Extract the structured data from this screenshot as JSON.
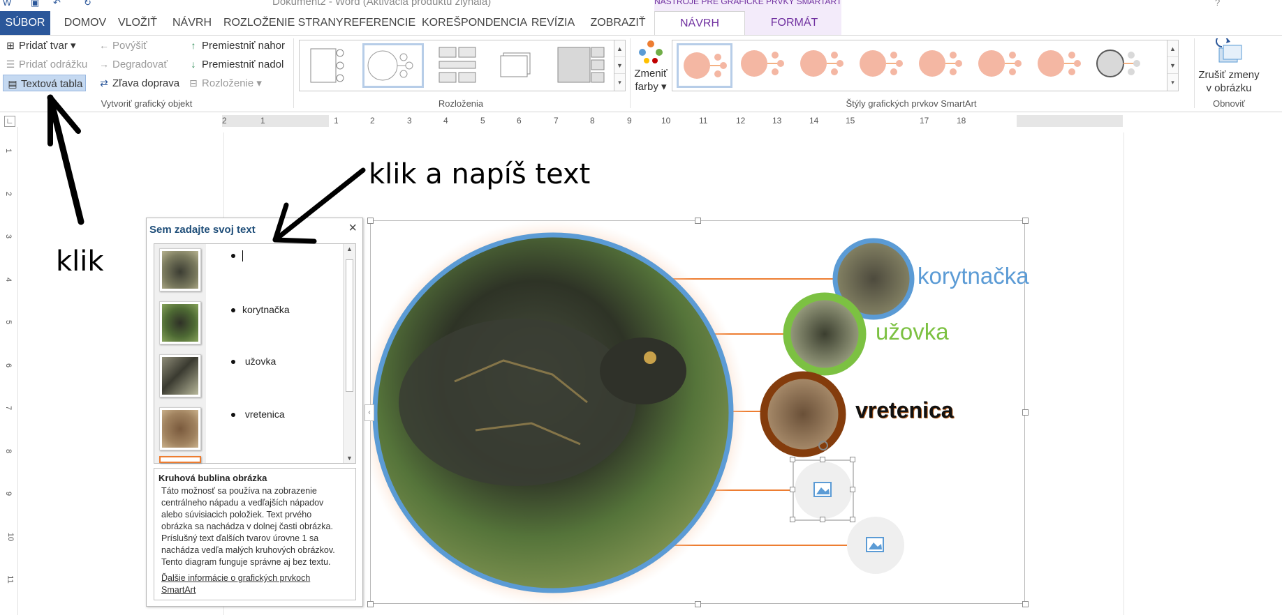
{
  "window": {
    "title": "Dokument2 - Word (Aktivácia produktu zlyhala)",
    "contextual_group": "NÁSTROJE PRE GRAFICKÉ PRVKY SMARTART"
  },
  "tabs": [
    {
      "label": "SÚBOR"
    },
    {
      "label": "DOMOV"
    },
    {
      "label": "VLOŽIŤ"
    },
    {
      "label": "NÁVRH"
    },
    {
      "label": "ROZLOŽENIE STRANY"
    },
    {
      "label": "REFERENCIE"
    },
    {
      "label": "KOREŠPONDENCIA"
    },
    {
      "label": "REVÍZIA"
    },
    {
      "label": "ZOBRAZIŤ"
    },
    {
      "label": "NÁVRH"
    },
    {
      "label": "FORMÁT"
    }
  ],
  "ribbon": {
    "create_group": {
      "label": "Vytvoriť grafický objekt",
      "add_shape": "Pridať tvar",
      "add_bullet": "Pridať odrážku",
      "text_pane": "Textová tabla",
      "promote": "Povýšiť",
      "demote": "Degradovať",
      "rtl": "Zľava doprava",
      "move_up": "Premiestniť nahor",
      "move_down": "Premiestniť nadol",
      "layout": "Rozloženie"
    },
    "layouts_group": {
      "label": "Rozloženia"
    },
    "styles_group": {
      "label": "Štýly grafických prvkov SmartArt",
      "change_colors_line1": "Zmeniť",
      "change_colors_line2": "farby"
    },
    "reset_group": {
      "label": "Obnoviť",
      "reset_line1": "Zrušiť zmeny",
      "reset_line2": "v obrázku"
    }
  },
  "ruler": {
    "h_numbers": [
      "2",
      "1",
      "1",
      "2",
      "3",
      "4",
      "5",
      "6",
      "7",
      "8",
      "9",
      "10",
      "11",
      "12",
      "13",
      "14",
      "15",
      "17",
      "18"
    ],
    "v_numbers": [
      "1",
      "2",
      "3",
      "4",
      "5",
      "6",
      "7",
      "8",
      "9",
      "10",
      "11"
    ]
  },
  "text_pane": {
    "title": "Sem zadajte svoj text",
    "items": [
      "",
      "korytnačka",
      "užovka",
      "vretenica"
    ],
    "desc_title": "Kruhová bublina obrázka",
    "desc_lines": [
      "Táto možnosť sa používa na zobrazenie",
      "centrálneho nápadu a vedľajších nápadov",
      "alebo súvisiacich položiek. Text prvého",
      "obrázka sa nachádza v dolnej časti obrázka.",
      "Príslušný text ďalších tvarov úrovne 1 sa",
      "nachádza vedľa malých kruhových obrázkov.",
      "Tento diagram funguje správne aj bez textu."
    ],
    "desc_link_line1": "Ďalšie informácie o grafických prvkoch",
    "desc_link_line2": "SmartArt"
  },
  "smartart": {
    "labels": [
      "korytnačka",
      "užovka",
      "vretenica"
    ],
    "colors": {
      "blue": "#5b9bd5",
      "green": "#7cc142",
      "brown": "#843c0c",
      "orange": "#ed7d31"
    }
  },
  "annotations": {
    "left": "klik",
    "top": "klik a napíš text"
  }
}
